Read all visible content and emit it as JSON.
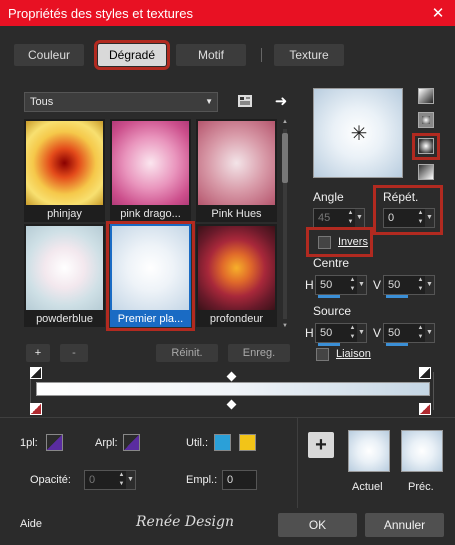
{
  "window": {
    "title": "Propriétés des styles et textures",
    "close_glyph": "✕"
  },
  "tabs": [
    {
      "label": "Couleur"
    },
    {
      "label": "Dégradé"
    },
    {
      "label": "Motif"
    },
    {
      "label": "Texture"
    }
  ],
  "gallery": {
    "category": "Tous",
    "items": [
      {
        "name": "phinjay"
      },
      {
        "name": "pink drago..."
      },
      {
        "name": "Pink Hues"
      },
      {
        "name": "powderblue"
      },
      {
        "name": "Premier pla..."
      },
      {
        "name": "profondeur"
      }
    ],
    "selected": "Premier pla..."
  },
  "buttons": {
    "add": "+",
    "remove": "-",
    "reset": "Réinit.",
    "save": "Enreg.",
    "ok": "OK",
    "cancel": "Annuler",
    "help": "Aide",
    "plus_big": "+"
  },
  "settings": {
    "angle_label": "Angle",
    "angle_value": "45",
    "repeat_label": "Répét.",
    "repeat_value": "0",
    "invert_label": "Invers",
    "center_label": "Centre",
    "center_h_label": "H",
    "center_h": "50",
    "center_v_label": "V",
    "center_v": "50",
    "source_label": "Source",
    "source_h_label": "H",
    "source_h": "50",
    "source_v_label": "V",
    "source_v": "50",
    "link_label": "Liaison"
  },
  "bottom": {
    "first_label": "1pl:",
    "back_label": "Arpl:",
    "use_label": "Util.:",
    "opacity_label": "Opacité:",
    "opacity_value": "0",
    "location_label": "Empl.:",
    "location_value": "0",
    "current_label": "Actuel",
    "previous_label": "Préc.",
    "brand": "Renée Design"
  },
  "colors": {
    "accent": "#1a6bc4",
    "highlight": "#b22a20",
    "titlebar": "#e81123",
    "use_color_1": "#2ba0d8",
    "use_color_2": "#f2c418",
    "first_plan": "#5a2ca0",
    "back_plan": "#5a2ca0"
  },
  "icons": [
    "close-icon",
    "gradient-library-icon",
    "arrow-right-icon",
    "star-center-icon",
    "linear-style-icon",
    "rectangular-style-icon",
    "sunburst-style-icon",
    "radial-style-icon"
  ]
}
